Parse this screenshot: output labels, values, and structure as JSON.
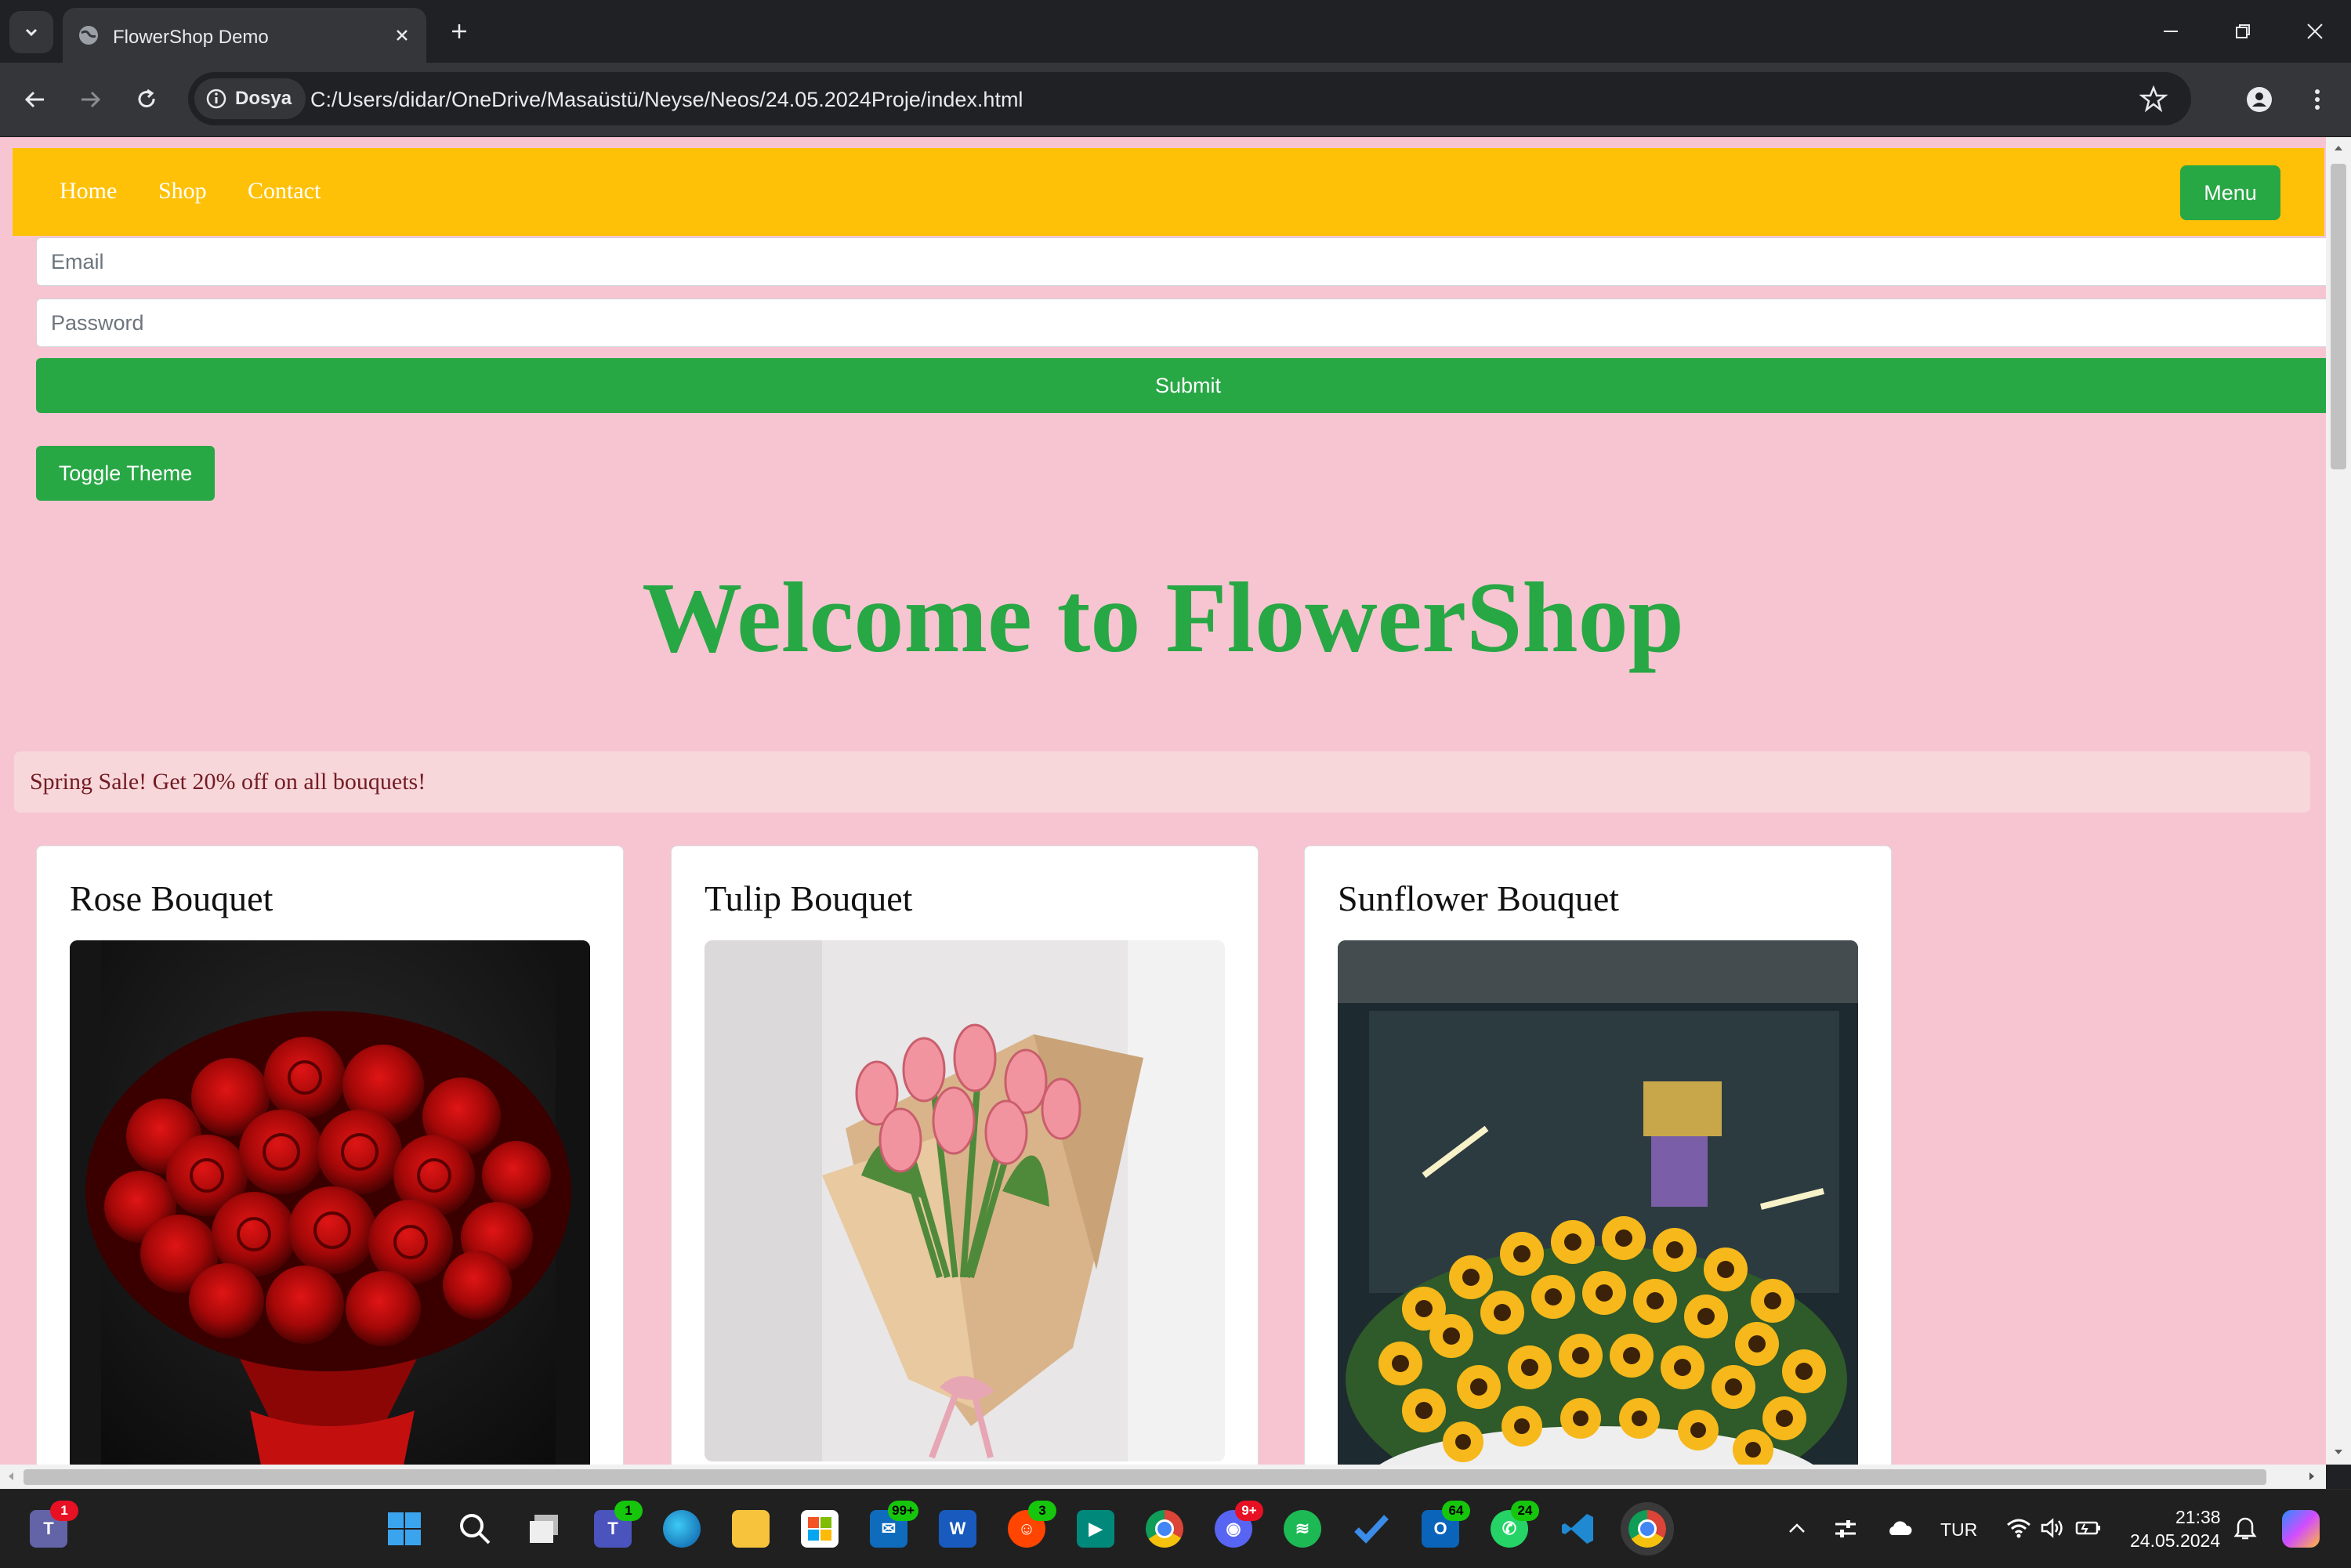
{
  "browser": {
    "tab_title": "FlowerShop Demo",
    "site_chip": "Dosya",
    "url": "C:/Users/didar/OneDrive/Masaüstü/Neyse/Neos/24.05.2024Proje/index.html"
  },
  "page": {
    "nav": {
      "home": "Home",
      "shop": "Shop",
      "contact": "Contact",
      "menu_button": "Menu"
    },
    "form": {
      "email_placeholder": "Email",
      "password_placeholder": "Password",
      "submit_label": "Submit"
    },
    "toggle_theme_label": "Toggle Theme",
    "heading": "Welcome to FlowerShop",
    "alert": "Spring Sale! Get 20% off on all bouquets!",
    "products": [
      {
        "title": "Rose Bouquet",
        "image": "red roses bouquet photo"
      },
      {
        "title": "Tulip Bouquet",
        "image": "pink tulips in kraft paper photo"
      },
      {
        "title": "Sunflower Bouquet",
        "image": "sunflower arrangement photo"
      }
    ],
    "colors": {
      "background": "#f7c5d1",
      "navbar": "#ffc107",
      "accent": "#28a745",
      "alert_bg": "#f8d7da"
    }
  },
  "taskbar": {
    "icons": [
      {
        "name": "teams-personal-icon",
        "badge": "1"
      },
      {
        "name": "windows-start-icon"
      },
      {
        "name": "search-icon"
      },
      {
        "name": "task-view-icon"
      },
      {
        "name": "teams-icon",
        "badge": "1"
      },
      {
        "name": "edge-icon"
      },
      {
        "name": "file-explorer-icon"
      },
      {
        "name": "microsoft-store-icon"
      },
      {
        "name": "mail-icon",
        "badge": "99+"
      },
      {
        "name": "word-icon"
      },
      {
        "name": "reddit-icon",
        "badge": "3"
      },
      {
        "name": "meet-icon"
      },
      {
        "name": "chrome-icon"
      },
      {
        "name": "discord-icon",
        "badge": "9+"
      },
      {
        "name": "spotify-icon"
      },
      {
        "name": "todo-icon"
      },
      {
        "name": "outlook-icon",
        "badge": "64"
      },
      {
        "name": "whatsapp-icon",
        "badge": "24"
      },
      {
        "name": "vscode-icon"
      },
      {
        "name": "chrome-active-icon"
      }
    ],
    "language": "TUR",
    "time": "21:38",
    "date": "24.05.2024"
  }
}
